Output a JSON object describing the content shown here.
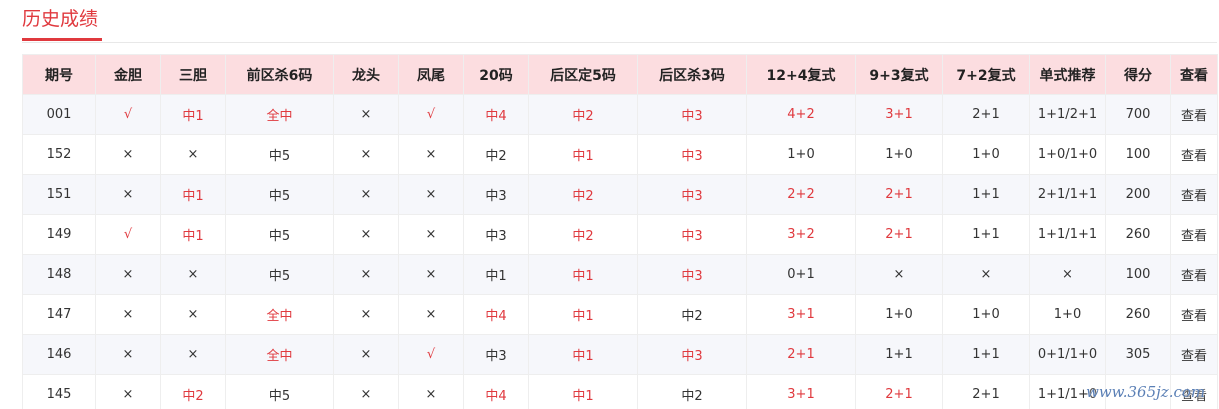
{
  "page": {
    "title": "历史成绩"
  },
  "colors": {
    "accent": "#e0393e",
    "header_bg": "#fcdde0",
    "row_alt_bg": "#f6f7fb"
  },
  "table": {
    "headers": [
      "期号",
      "金胆",
      "三胆",
      "前区杀6码",
      "龙头",
      "凤尾",
      "20码",
      "后区定5码",
      "后区杀3码",
      "12+4复式",
      "9+3复式",
      "7+2复式",
      "单式推荐",
      "得分",
      "查看"
    ],
    "rows": [
      {
        "cells": [
          "001",
          "√",
          "中1",
          "全中",
          "×",
          "√",
          "中4",
          "中2",
          "中3",
          "4+2",
          "3+1",
          "2+1",
          "1+1/2+1",
          "700",
          "查看"
        ],
        "hits": [
          1,
          2,
          3,
          5,
          6,
          7,
          8,
          9,
          10
        ]
      },
      {
        "cells": [
          "152",
          "×",
          "×",
          "中5",
          "×",
          "×",
          "中2",
          "中1",
          "中3",
          "1+0",
          "1+0",
          "1+0",
          "1+0/1+0",
          "100",
          "查看"
        ],
        "hits": [
          7,
          8
        ]
      },
      {
        "cells": [
          "151",
          "×",
          "中1",
          "中5",
          "×",
          "×",
          "中3",
          "中2",
          "中3",
          "2+2",
          "2+1",
          "1+1",
          "2+1/1+1",
          "200",
          "查看"
        ],
        "hits": [
          2,
          7,
          8,
          9,
          10
        ]
      },
      {
        "cells": [
          "149",
          "√",
          "中1",
          "中5",
          "×",
          "×",
          "中3",
          "中2",
          "中3",
          "3+2",
          "2+1",
          "1+1",
          "1+1/1+1",
          "260",
          "查看"
        ],
        "hits": [
          1,
          2,
          7,
          8,
          9,
          10
        ]
      },
      {
        "cells": [
          "148",
          "×",
          "×",
          "中5",
          "×",
          "×",
          "中1",
          "中1",
          "中3",
          "0+1",
          "×",
          "×",
          "×",
          "100",
          "查看"
        ],
        "hits": [
          7,
          8
        ]
      },
      {
        "cells": [
          "147",
          "×",
          "×",
          "全中",
          "×",
          "×",
          "中4",
          "中1",
          "中2",
          "3+1",
          "1+0",
          "1+0",
          "1+0",
          "260",
          "查看"
        ],
        "hits": [
          3,
          6,
          7,
          9
        ]
      },
      {
        "cells": [
          "146",
          "×",
          "×",
          "全中",
          "×",
          "√",
          "中3",
          "中1",
          "中3",
          "2+1",
          "1+1",
          "1+1",
          "0+1/1+0",
          "305",
          "查看"
        ],
        "hits": [
          3,
          5,
          7,
          8,
          9
        ]
      },
      {
        "cells": [
          "145",
          "×",
          "中2",
          "中5",
          "×",
          "×",
          "中4",
          "中1",
          "中2",
          "3+1",
          "2+1",
          "2+1",
          "1+1/1+0",
          "",
          "查看"
        ],
        "hits": [
          2,
          6,
          7,
          9,
          10
        ]
      }
    ]
  },
  "watermark": {
    "text": "www.365jz.com"
  }
}
